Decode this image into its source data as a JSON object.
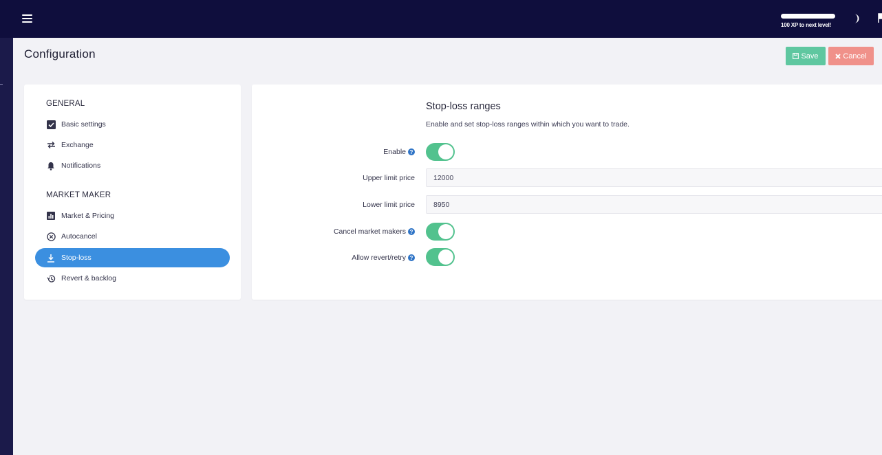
{
  "header": {
    "xp_label": "100 XP to next level!",
    "xp_progress": 1.0,
    "icons": {
      "menu": "menu-icon",
      "theme": "moon-icon",
      "flag": "flag-icon"
    }
  },
  "page": {
    "title": "Configuration"
  },
  "actions": {
    "save_label": "Save",
    "cancel_label": "Cancel"
  },
  "sidebar": {
    "sections": [
      {
        "heading": "GENERAL",
        "items": [
          {
            "label": "Basic settings",
            "icon": "checkbox-icon"
          },
          {
            "label": "Exchange",
            "icon": "swap-arrows-icon"
          },
          {
            "label": "Notifications",
            "icon": "bell-icon"
          }
        ]
      },
      {
        "heading": "MARKET MAKER",
        "items": [
          {
            "label": "Market & Pricing",
            "icon": "bar-chart-icon"
          },
          {
            "label": "Autocancel",
            "icon": "circle-x-icon"
          },
          {
            "label": "Stop-loss",
            "icon": "download-arrow-icon",
            "active": true
          },
          {
            "label": "Revert & backlog",
            "icon": "history-icon"
          }
        ]
      }
    ]
  },
  "form": {
    "title": "Stop-loss ranges",
    "description": "Enable and set stop-loss ranges within which you want to trade.",
    "fields": {
      "enable": {
        "label": "Enable",
        "value": true
      },
      "upper": {
        "label": "Upper limit price",
        "value": "12000"
      },
      "lower": {
        "label": "Lower limit price",
        "value": "8950"
      },
      "cancel_mm": {
        "label": "Cancel market makers",
        "value": true
      },
      "revert": {
        "label": "Allow revert/retry",
        "value": true
      }
    }
  },
  "colors": {
    "topbar": "#0f0e3d",
    "save": "#5fc7a0",
    "cancel": "#f0918a",
    "active_nav": "#3b8fe0",
    "toggle_on": "#52c28e",
    "help": "#2f74c6"
  }
}
